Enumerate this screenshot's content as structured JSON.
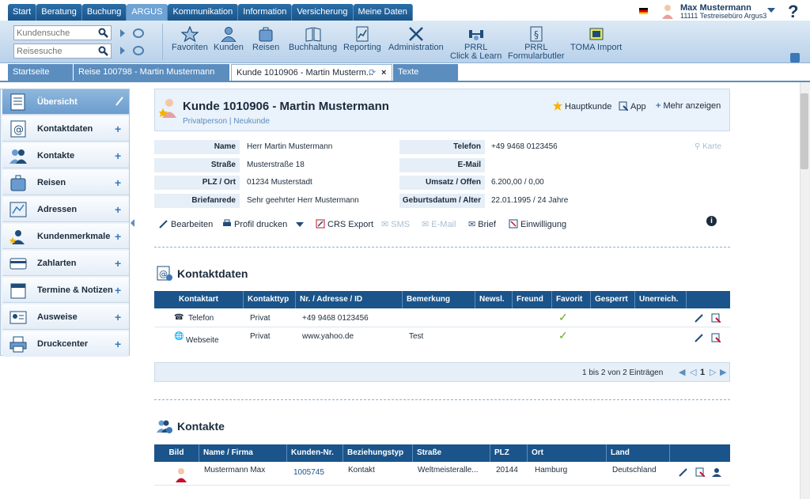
{
  "nav": {
    "tabs": [
      "Start",
      "Beratung",
      "Buchung",
      "ARGUS",
      "Kommunikation",
      "Information",
      "Versicherung",
      "Meine Daten"
    ],
    "active": "ARGUS"
  },
  "user": {
    "name": "Max Mustermann",
    "office": "11111 Testreisebüro Argus3"
  },
  "help_label": "?",
  "toolbar": {
    "customer_search_placeholder": "Kundensuche",
    "trip_search_placeholder": "Reisesuche",
    "tools": [
      {
        "label": "Favoriten",
        "icon": "star-icon"
      },
      {
        "label": "Kunden",
        "icon": "person-icon"
      },
      {
        "label": "Reisen",
        "icon": "suitcase-icon"
      },
      {
        "label": "Buchhaltung",
        "icon": "book-icon"
      },
      {
        "label": "Reporting",
        "icon": "report-icon"
      },
      {
        "label": "Administration",
        "icon": "tools-icon"
      },
      {
        "label": "PRRL\nClick & Learn",
        "icon": "weights-icon"
      },
      {
        "label": "PRRL\nFormularbutler",
        "icon": "paragraph-icon"
      },
      {
        "label": "TOMA Import",
        "icon": "toma-icon"
      }
    ]
  },
  "page_tabs": [
    {
      "label": "Startseite"
    },
    {
      "label": "Reise 100798 - Martin Mustermann"
    },
    {
      "label": "Kunde 1010906 - Martin Musterm..."
    },
    {
      "label": "Texte"
    }
  ],
  "sidebar": {
    "items": [
      {
        "label": "Übersicht",
        "icon": "overview-icon"
      },
      {
        "label": "Kontaktdaten",
        "icon": "at-icon"
      },
      {
        "label": "Kontakte",
        "icon": "contacts-icon"
      },
      {
        "label": "Reisen",
        "icon": "suitcase-icon"
      },
      {
        "label": "Adressen",
        "icon": "map-icon"
      },
      {
        "label": "Kundenmerkmale",
        "icon": "person-star-icon"
      },
      {
        "label": "Zahlarten",
        "icon": "card-icon"
      },
      {
        "label": "Termine & Notizen",
        "icon": "calendar-icon"
      },
      {
        "label": "Ausweise",
        "icon": "id-card-icon"
      },
      {
        "label": "Druckcenter",
        "icon": "printer-icon"
      }
    ]
  },
  "customer": {
    "title": "Kunde 1010906 - Martin Mustermann",
    "subtitle": "Privatperson | Neukunde",
    "header_links": [
      "Hauptkunde",
      "App",
      "Mehr anzeigen"
    ],
    "left_fields": [
      {
        "label": "Name",
        "value": "Herr Martin Mustermann"
      },
      {
        "label": "Straße",
        "value": "Musterstraße 18"
      },
      {
        "label": "PLZ / Ort",
        "value": "01234 Musterstadt"
      },
      {
        "label": "Briefanrede",
        "value": "Sehr geehrter Herr Mustermann"
      }
    ],
    "right_fields": [
      {
        "label": "Telefon",
        "value": "+49 9468 0123456"
      },
      {
        "label": "E-Mail",
        "value": ""
      },
      {
        "label": "Umsatz / Offen",
        "value": "6.200,00 / 0,00"
      },
      {
        "label": "Geburtsdatum / Alter",
        "value": "22.01.1995 / 24 Jahre"
      }
    ],
    "map_link": "Karte"
  },
  "actions": [
    "Bearbeiten",
    "Profil drucken",
    "CRS Export",
    "SMS",
    "E-Mail",
    "Brief",
    "Einwilligung"
  ],
  "contact_data": {
    "title": "Kontaktdaten",
    "columns": [
      "Kontaktart",
      "Kontakttyp",
      "Nr. / Adresse / ID",
      "Bemerkung",
      "Newsl.",
      "Freund",
      "Favorit",
      "Gesperrt",
      "Unerreich."
    ],
    "rows": [
      {
        "art": "Telefon",
        "typ": "Privat",
        "nr": "+49 9468 0123456",
        "bemerkung": "",
        "favorit": "✓"
      },
      {
        "art": "Webseite",
        "typ": "Privat",
        "nr": "www.yahoo.de",
        "bemerkung": "Test",
        "favorit": "✓"
      }
    ],
    "pager_text": "1 bis 2 von 2 Einträgen",
    "page": "1"
  },
  "contacts": {
    "title": "Kontakte",
    "columns": [
      "Bild",
      "Name / Firma",
      "Kunden-Nr.",
      "Beziehungstyp",
      "Straße",
      "PLZ",
      "Ort",
      "Land"
    ],
    "rows": [
      {
        "name": "Mustermann Max",
        "nr": "1005745",
        "typ": "Kontakt",
        "strasse": "Weltmeisteralle...",
        "plz": "20144",
        "ort": "Hamburg",
        "land": "Deutschland"
      }
    ]
  },
  "colors": {
    "nav": "#1a548a",
    "accent": "#5b8dbf",
    "check": "#6aa82a"
  }
}
